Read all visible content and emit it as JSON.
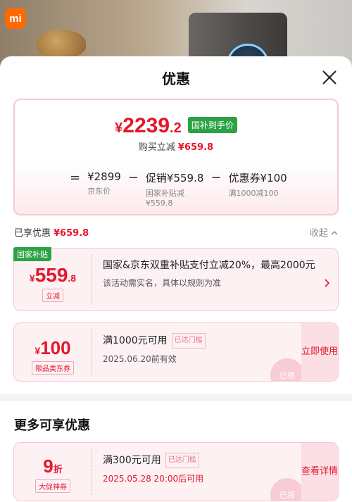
{
  "brand_logo": "mi",
  "sheet": {
    "title": "优惠",
    "close_icon": "close-icon"
  },
  "price_card": {
    "final_currency": "¥",
    "final_int": "2239",
    "final_dec": ".2",
    "final_tag": "国补到手价",
    "buy_label": "购买立减",
    "buy_amount": "¥659.8",
    "formula": {
      "equals": "=",
      "base_price": "¥2899",
      "base_label": "京东价",
      "minus1": "−",
      "promo": "促销¥559.8",
      "promo_sub1": "国家补贴减",
      "promo_sub2": "¥559.8",
      "minus2": "−",
      "coupon": "优惠券¥100",
      "coupon_sub": "满1000减100"
    }
  },
  "enjoyed": {
    "label": "已享优惠",
    "amount": "¥659.8",
    "collapse": "收起",
    "collapse_icon": "chevron-up-icon"
  },
  "gov_coupon": {
    "tag": "国家补贴",
    "currency": "¥",
    "amount": "559",
    "dec": ".8",
    "kind": "立减",
    "title": "国家&京东双重补贴支付立减20%，最高2000元",
    "desc": "该活动需实名，具体以规则为准",
    "chev_icon": "chevron-right-icon"
  },
  "coupon_100": {
    "currency": "¥",
    "amount": "100",
    "kind": "限品类东券",
    "title": "满1000元可用",
    "chip": "已达门槛",
    "desc": "2025.06.20前有效",
    "action": "立即使用",
    "stamp": "已领"
  },
  "more": {
    "title": "更多可享优惠"
  },
  "coupon_9": {
    "amount": "9",
    "unit": "折",
    "kind": "大促神券",
    "title": "满300元可用",
    "chip": "已达门槛",
    "desc": "2025.05.28 20:00后可用",
    "action": "查看详情",
    "stamp": "已领"
  }
}
